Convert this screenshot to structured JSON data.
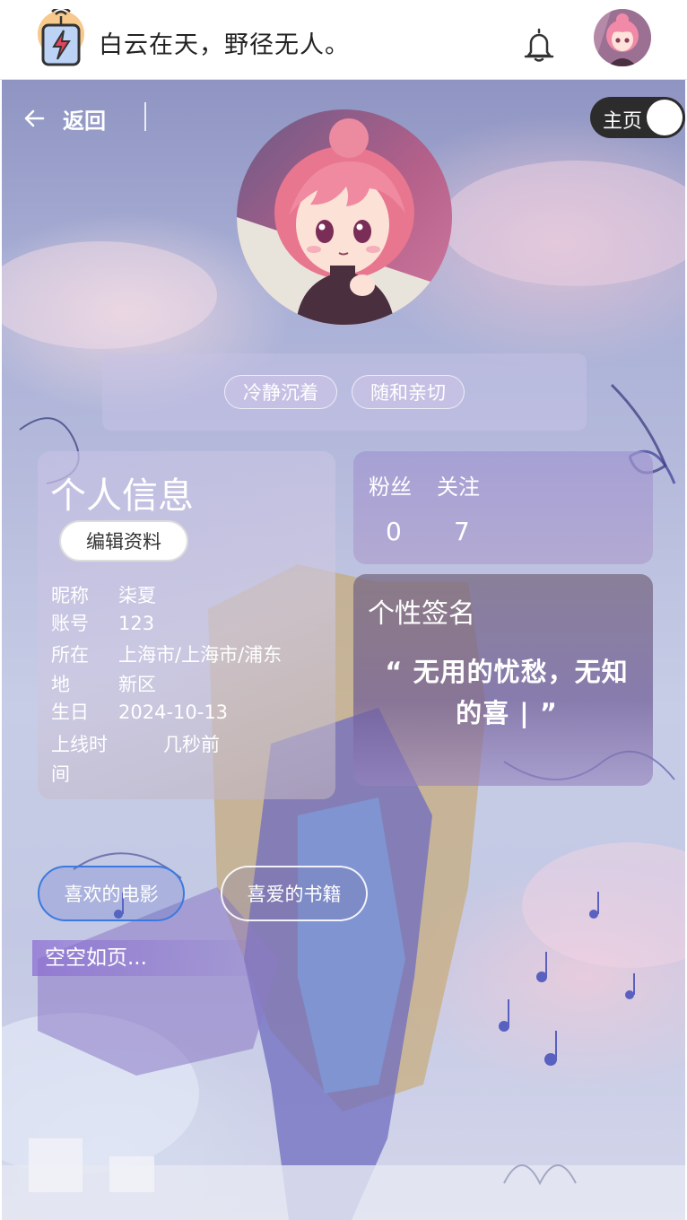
{
  "header": {
    "slogan": "白云在天，野径无人。",
    "logo_icon": "lightning-bolt-icon",
    "bell_icon": "bell-icon"
  },
  "nav": {
    "back_label": "返回",
    "home_toggle_label": "主页"
  },
  "profile": {
    "tags": [
      "冷静沉着",
      "随和亲切"
    ]
  },
  "info": {
    "title": "个人信息",
    "edit_label": "编辑资料",
    "fields": [
      {
        "k": "昵称",
        "v": "柒夏"
      },
      {
        "k": "账号",
        "v": "123"
      },
      {
        "k": "所在地",
        "v": "上海市/上海市/浦东新区"
      },
      {
        "k": "生日",
        "v": "2024-10-13"
      },
      {
        "k": "上线时间",
        "v": "几秒前"
      }
    ]
  },
  "stats": {
    "fans_label": "粉丝",
    "fans_value": "0",
    "follow_label": "关注",
    "follow_value": "7"
  },
  "signature": {
    "title": "个性签名",
    "text": "“ 无用的忧愁，无知的喜 | ”"
  },
  "tabs": [
    {
      "label": "喜欢的电影"
    },
    {
      "label": "喜爱的书籍"
    }
  ],
  "empty_text": "空空如页...",
  "colors": {
    "accent_tab_border": "#3a7ae0",
    "toggle_bg": "#2c2c2c"
  }
}
